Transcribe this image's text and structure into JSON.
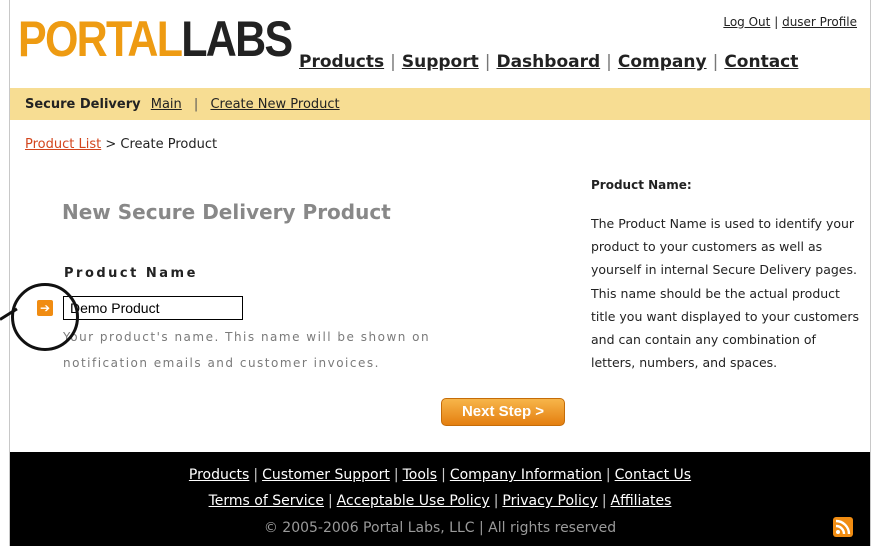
{
  "logo": {
    "part1": "PORTAL",
    "part2": "LABS"
  },
  "top_links": {
    "logout": "Log Out",
    "separator": "|",
    "profile": "duser Profile"
  },
  "main_nav": {
    "items": [
      "Products",
      "Support",
      "Dashboard",
      "Company",
      "Contact"
    ],
    "separator": "|"
  },
  "secure_bar": {
    "title": "Secure Delivery",
    "main": "Main",
    "separator": "|",
    "create": "Create New Product"
  },
  "breadcrumb": {
    "link": "Product List",
    "separator": ">",
    "current": "Create Product"
  },
  "form": {
    "title": "New Secure Delivery Product",
    "field_label": "Product Name",
    "field_value": "Demo Product",
    "help_text": "Your product's name. This name will be shown on notification emails and customer invoices.",
    "next_button": "Next Step >"
  },
  "sidebar": {
    "title": "Product Name:",
    "text": "The Product Name is used to identify your product to your customers as well as yourself in internal Secure Delivery pages. This name should be the actual product title you want displayed to your customers and can contain any combination of letters, numbers, and spaces."
  },
  "footer": {
    "row1": [
      "Products",
      "Customer Support",
      "Tools",
      "Company Information",
      "Contact Us"
    ],
    "row2": [
      "Terms of Service",
      "Acceptable Use Policy",
      "Privacy Policy",
      "Affiliates"
    ],
    "separator": "|",
    "copyright": "© 2005-2006 Portal Labs, LLC | All rights reserved"
  },
  "colors": {
    "accent": "#ee9b12",
    "bar": "#f7dd93",
    "link_red": "#d3451d",
    "footer_bg": "#000000"
  },
  "icons": {
    "field_arrow": "arrow-right-icon",
    "feed": "rss-icon"
  }
}
